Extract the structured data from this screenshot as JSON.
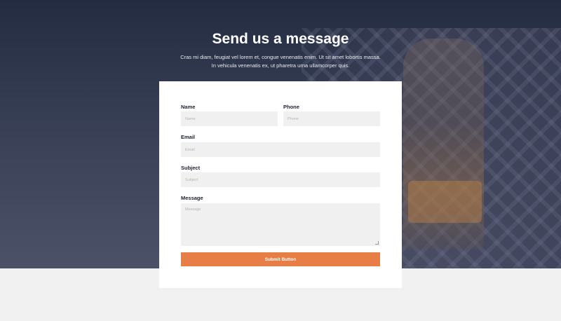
{
  "header": {
    "title": "Send us a message",
    "subtitle_line1": "Cras mi diam, feugiat vel lorem et, congue venenatis enim. Ut sit amet lobortis massa.",
    "subtitle_line2": "In vehicula venenatis ex, ut pharetra urna ullamcorper quis."
  },
  "form": {
    "name": {
      "label": "Name",
      "placeholder": "Name",
      "value": ""
    },
    "phone": {
      "label": "Phone",
      "placeholder": "Phone",
      "value": ""
    },
    "email": {
      "label": "Email",
      "placeholder": "Email",
      "value": ""
    },
    "subject": {
      "label": "Subject",
      "placeholder": "Subject",
      "value": ""
    },
    "message": {
      "label": "Message",
      "placeholder": "Message",
      "value": ""
    },
    "submit_label": "Submit Button"
  },
  "colors": {
    "hero_overlay": "#1b243a",
    "button": "#e67e45",
    "field_bg": "#f0f0f0",
    "page_bg": "#f1f1f1"
  }
}
